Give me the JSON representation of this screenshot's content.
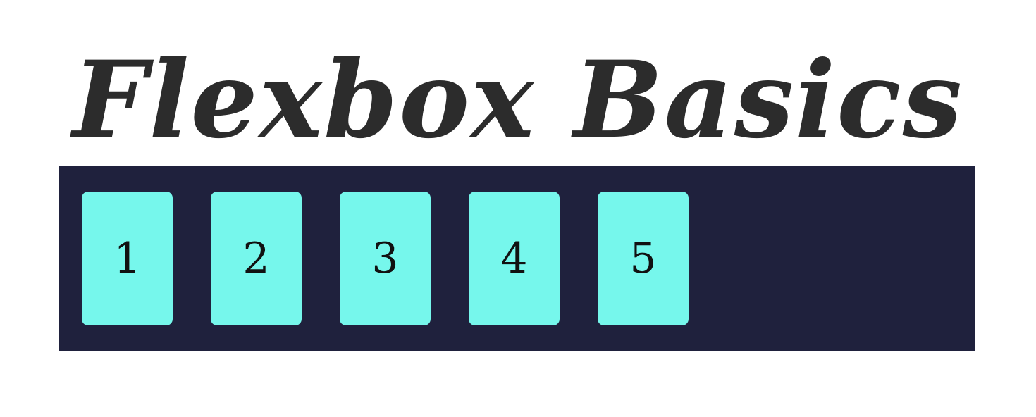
{
  "header": {
    "title": "Flexbox Basics"
  },
  "container": {
    "items": [
      {
        "label": "1"
      },
      {
        "label": "2"
      },
      {
        "label": "3"
      },
      {
        "label": "4"
      },
      {
        "label": "5"
      }
    ]
  },
  "colors": {
    "container_background": "#1f213d",
    "item_background": "#76f7ec",
    "title_text": "#2c2c2c",
    "item_text": "#111111"
  }
}
